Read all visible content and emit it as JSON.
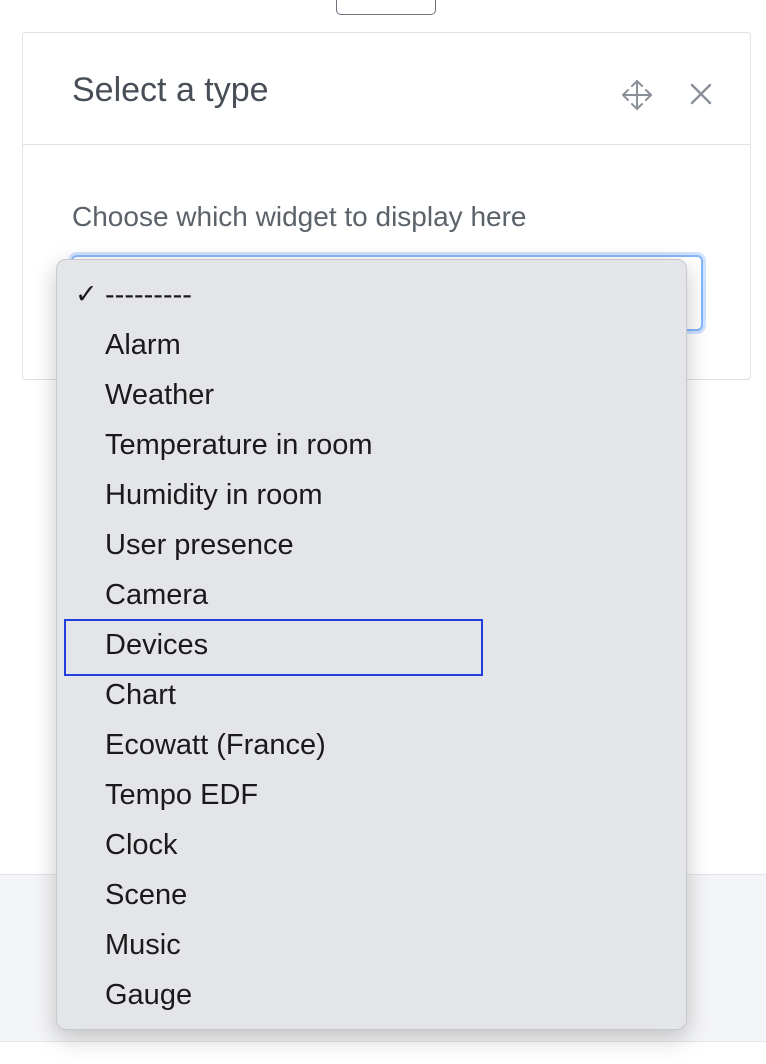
{
  "modal": {
    "title": "Select a type",
    "move_icon": "move-arrows-icon",
    "close_icon": "close-icon",
    "prompt": "Choose which widget to display here"
  },
  "select": {
    "selected_value": "---------",
    "options": [
      "---------",
      "Alarm",
      "Weather",
      "Temperature in room",
      "Humidity in room",
      "User presence",
      "Camera",
      "Devices",
      "Chart",
      "Ecowatt (France)",
      "Tempo EDF",
      "Clock",
      "Scene",
      "Music",
      "Gauge"
    ],
    "checked_index": 0,
    "focused_index": 7
  },
  "colors": {
    "focus": "#1f3fe0",
    "select_border": "#86b7fe",
    "dropdown_bg": "#e4e5e9"
  }
}
